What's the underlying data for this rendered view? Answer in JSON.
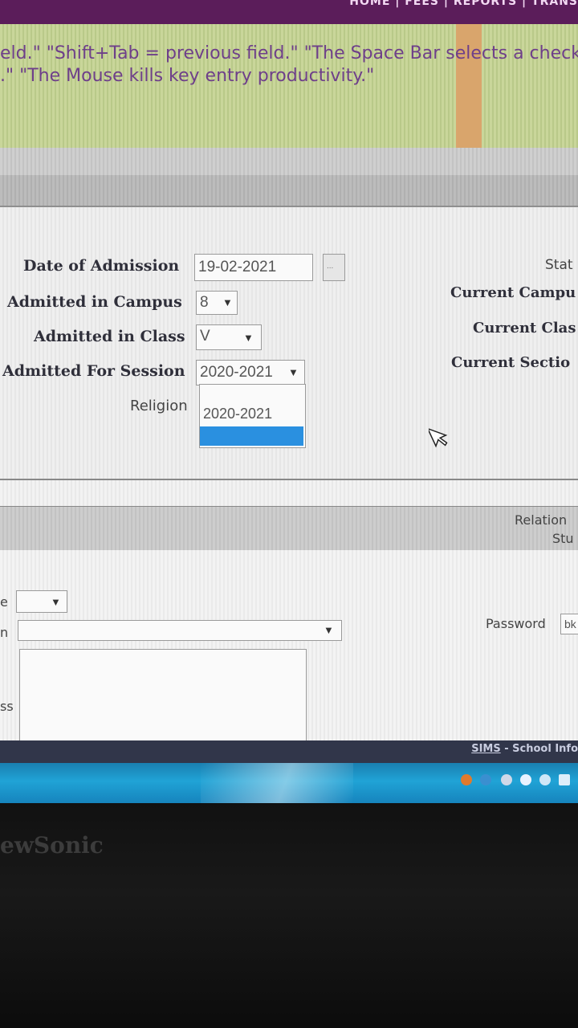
{
  "top_nav": {
    "links_text": "HOME | FEES | REPORTS | TRANS"
  },
  "tip": {
    "line1": "eld.\" \"Shift+Tab = previous field.\" \"The Space Bar selects a checkbo",
    "line2": ".\" \"The Mouse kills key entry productivity.\""
  },
  "form": {
    "date_of_admission": {
      "label": "Date of Admission",
      "value": "19-02-2021",
      "picker_label": "..."
    },
    "admitted_in_campus": {
      "label": "Admitted in Campus",
      "value": "8"
    },
    "admitted_in_class": {
      "label": "Admitted in Class",
      "value": "V"
    },
    "admitted_for_session": {
      "label": "Admitted For Session",
      "value": "2020-2021",
      "options": [
        "2020-2021",
        ""
      ]
    },
    "religion": {
      "label": "Religion"
    },
    "right": {
      "status_label": "Stat",
      "current_campus_label": "Current Campu",
      "current_class_label": "Current Clas",
      "current_section_label": "Current Sectio"
    }
  },
  "section2": {
    "relation_label": "Relation",
    "student_label": "Stu",
    "left_label_1": "e",
    "left_label_2": "n",
    "left_label_3": "ss",
    "password_label": "Password",
    "password_value": "bk"
  },
  "footer": {
    "link": "SIMS",
    "text": " - School Info"
  },
  "monitor": {
    "brand": "ewSonic"
  },
  "colors": {
    "nav": "#5b1d5a",
    "tip_text": "#6e3f8a",
    "selection": "#2a90e0",
    "taskbar": "#1a7fb0"
  }
}
